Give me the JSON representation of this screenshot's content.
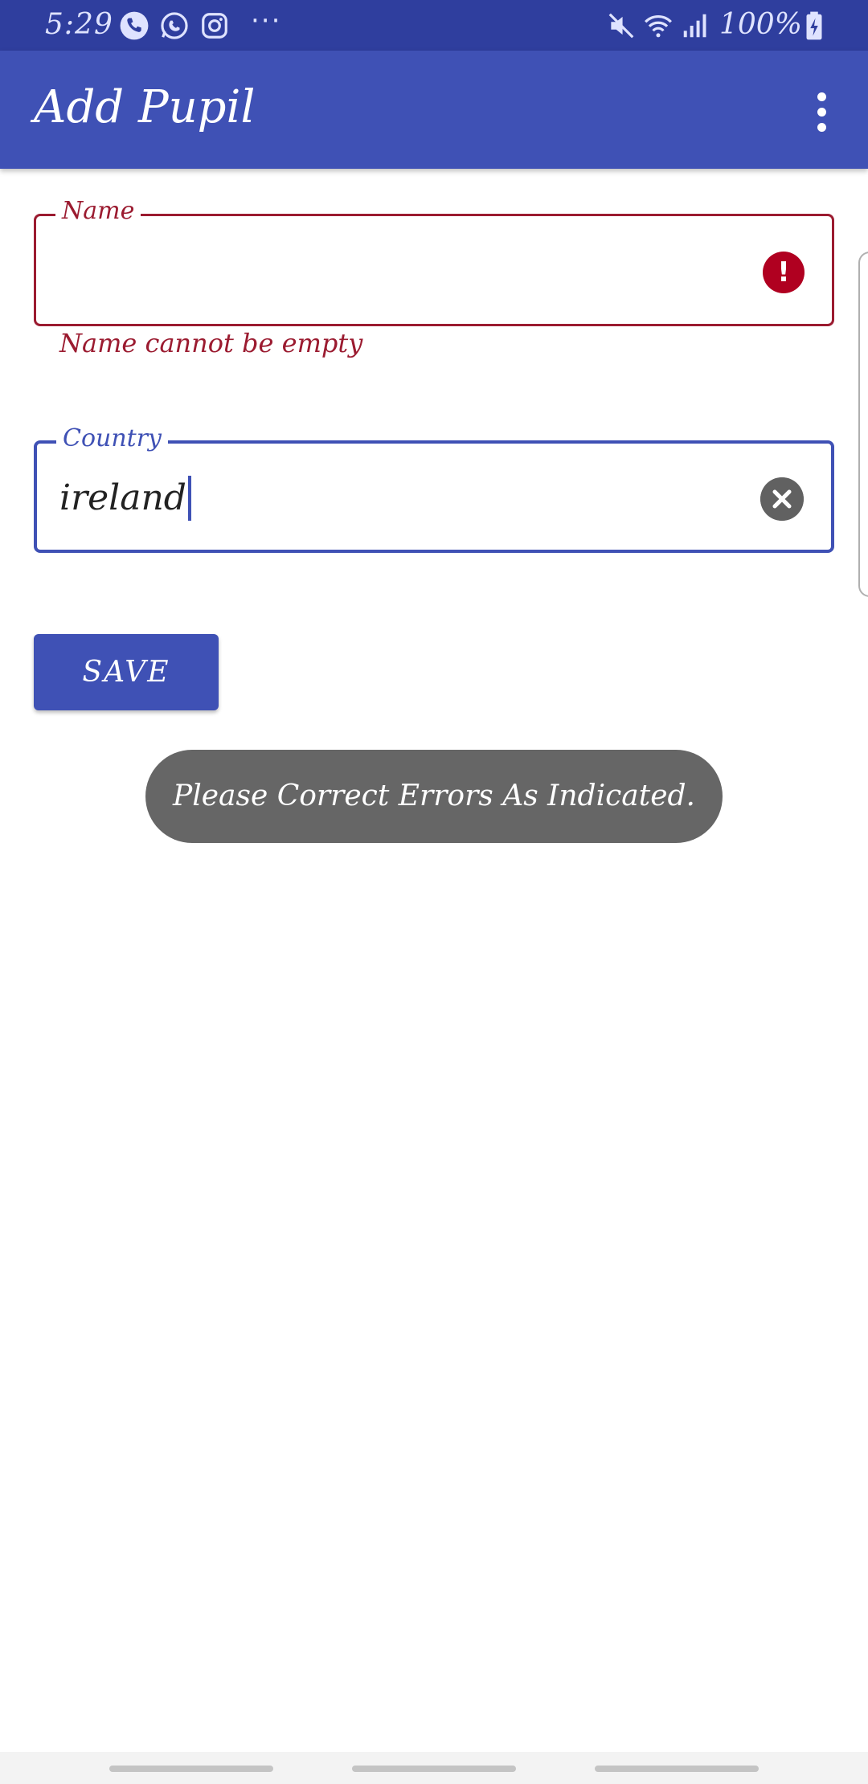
{
  "status_bar": {
    "time": "5:29",
    "battery": "100%",
    "icons": [
      "phone-icon",
      "whatsapp-icon",
      "instagram-icon",
      "more-dots-icon",
      "mute-icon",
      "wifi-icon",
      "signal-icon",
      "battery-charging-icon"
    ],
    "dots": "···"
  },
  "app_bar": {
    "title": "Add Pupil"
  },
  "form": {
    "name": {
      "label": "Name",
      "value": "",
      "error": "Name cannot be empty"
    },
    "country": {
      "label": "Country",
      "value": "ireland"
    },
    "save_label": "SAVE"
  },
  "toast": {
    "message": "Please Correct Errors As Indicated."
  },
  "colors": {
    "primary": "#3f51b5",
    "status_bar": "#2f3e9e",
    "error": "#b00020",
    "toast": "#666666"
  }
}
